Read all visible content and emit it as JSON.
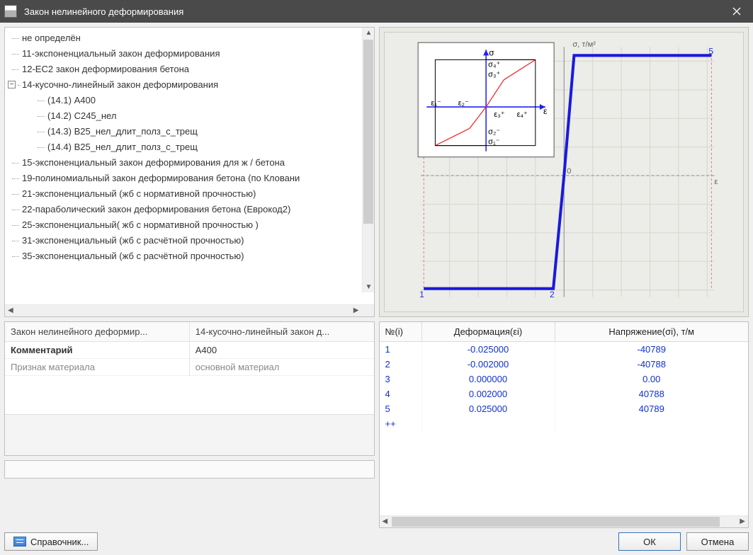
{
  "window": {
    "title": "Закон нелинейного деформирования"
  },
  "tree": {
    "items": [
      "не определён",
      "11-экспоненциальный закон деформирования",
      "12-EC2 закон деформирования бетона"
    ],
    "group14_label": "14-кусочно-линейный закон деформирования",
    "group14_children": [
      "(14.1) А400",
      "(14.2) С245_нел",
      "(14.3) В25_нел_длит_полз_с_трещ",
      "(14.4) В25_нел_длит_полз_с_трещ"
    ],
    "items_after": [
      "15-экспоненциальный закон деформирования для ж / бетона",
      "19-полиномиальный закон деформирования бетона (по Кловани",
      "21-экспоненциальный (жб с нормативной прочностью)",
      "22-параболический закон деформирования бетона (Еврокод2)",
      "25-экспоненциальный( жб с нормативной прочностью )",
      "31-экспоненциальный (жб с расчётной прочностью)",
      "35-экспоненциальный (жб с расчётной прочностью)"
    ]
  },
  "props": {
    "header_left": "Закон нелинейного деформир...",
    "header_right": "14-кусочно-линейный закон д...",
    "rows": [
      {
        "k": "Комментарий",
        "v": "А400"
      },
      {
        "k": "Признак материала",
        "v": "основной материал"
      }
    ]
  },
  "chart_data": {
    "type": "line",
    "title": "",
    "xlabel": "ε",
    "ylabel": "σ, т/м²",
    "x": [
      -0.025,
      -0.002,
      0.0,
      0.002,
      0.025
    ],
    "y": [
      -40789,
      -40788,
      0.0,
      40788,
      40789
    ],
    "point_labels": [
      "1",
      "2",
      "",
      "",
      "5"
    ],
    "xlim": [
      -0.028,
      0.028
    ],
    "ylim": [
      -45000,
      45000
    ]
  },
  "table": {
    "headers": {
      "n": "№(i)",
      "d": "Деформация(εi)",
      "s": "Напряжение(σi), т/м"
    },
    "rows": [
      {
        "n": "1",
        "d": "-0.025000",
        "s": "-40789"
      },
      {
        "n": "2",
        "d": "-0.002000",
        "s": "-40788"
      },
      {
        "n": "3",
        "d": "0.000000",
        "s": "0.00"
      },
      {
        "n": "4",
        "d": "0.002000",
        "s": "40788"
      },
      {
        "n": "5",
        "d": "0.025000",
        "s": "40789"
      }
    ],
    "add_row_marker": "++"
  },
  "buttons": {
    "reference": "Справочник...",
    "ok": "ОК",
    "cancel": "Отмена"
  }
}
